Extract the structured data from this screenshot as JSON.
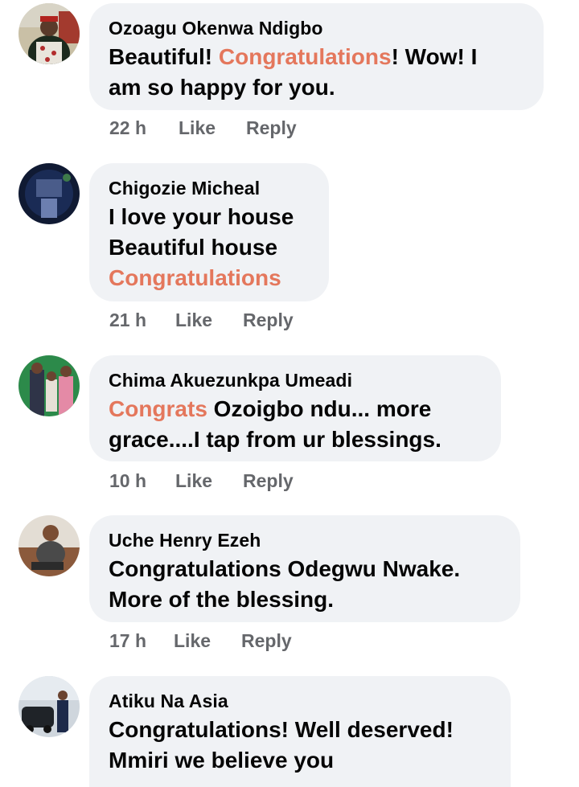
{
  "comments": [
    {
      "author": "Ozoagu Okenwa Ndigbo",
      "lines": [
        [
          {
            "t": "Beautiful! ",
            "h": false
          },
          {
            "t": "Congratulations",
            "h": true
          },
          {
            "t": "! Wow! I",
            "h": false
          }
        ],
        [
          {
            "t": "am so happy for you.",
            "h": false
          }
        ]
      ],
      "time": "22 h",
      "like": "Like",
      "reply": "Reply"
    },
    {
      "author": "Chigozie Micheal",
      "lines": [
        [
          {
            "t": "I love your house",
            "h": false
          }
        ],
        [
          {
            "t": "Beautiful house",
            "h": false
          }
        ],
        [
          {
            "t": "Congratulations",
            "h": true
          }
        ]
      ],
      "time": "21 h",
      "like": "Like",
      "reply": "Reply"
    },
    {
      "author": "Chima Akuezunkpa Umeadi",
      "lines": [
        [
          {
            "t": "Congrats",
            "h": true
          },
          {
            "t": " Ozoigbo ndu... more",
            "h": false
          }
        ],
        [
          {
            "t": "grace....I tap from ur blessings.",
            "h": false
          }
        ]
      ],
      "time": "10 h",
      "like": "Like",
      "reply": "Reply"
    },
    {
      "author": "Uche Henry Ezeh",
      "lines": [
        [
          {
            "t": "Congratulations Odegwu Nwake.",
            "h": false
          }
        ],
        [
          {
            "t": "More of the blessing.",
            "h": false
          }
        ]
      ],
      "time": "17 h",
      "like": "Like",
      "reply": "Reply"
    },
    {
      "author": "Atiku Na Asia",
      "lines": [
        [
          {
            "t": "Congratulations! Well deserved!",
            "h": false
          }
        ],
        [
          {
            "t": "Mmiri we believe you",
            "h": false
          }
        ]
      ],
      "time": "",
      "like": "",
      "reply": ""
    }
  ],
  "colors": {
    "highlight": "#e4775c",
    "bubble": "#f0f2f5",
    "meta": "#65676b",
    "text": "#050505"
  }
}
